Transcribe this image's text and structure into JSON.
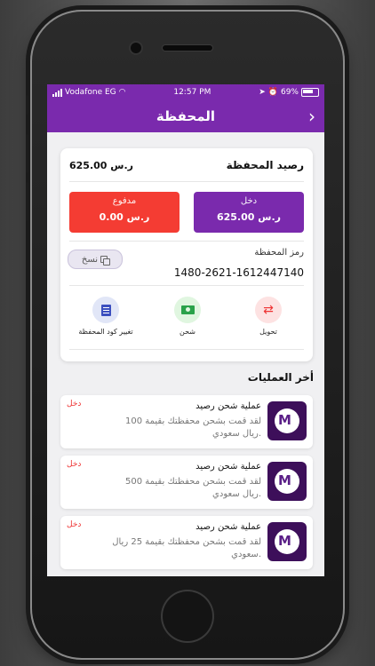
{
  "status": {
    "carrier": "Vodafone EG",
    "time": "12:57 PM",
    "battery": "69%"
  },
  "header": {
    "title": "المحفظة"
  },
  "wallet": {
    "balance_title": "رصيد المحفظة",
    "balance_amount": "625.00 ر.س",
    "income_label": "دخل",
    "income_value": "625.00 ر.س",
    "paid_label": "مدفوع",
    "paid_value": "0.00 ر.س",
    "code_label": "رمز المحفظة",
    "code_value": "1480-2621-1612447140",
    "copy_label": "نسخ"
  },
  "actions": [
    {
      "label": "تحويل",
      "icon": "transfer-arrows-icon"
    },
    {
      "label": "شحن",
      "icon": "cash-icon"
    },
    {
      "label": "تغيير كود المحفظة",
      "icon": "document-icon"
    }
  ],
  "transactions_title": "أخر العمليات",
  "transactions": [
    {
      "title": "عملية شحن رصيد",
      "desc": "لقد قمت بشحن محفظتك بقيمة 100 ريال سعودي.",
      "type": "دخل"
    },
    {
      "title": "عملية شحن رصيد",
      "desc": "لقد قمت بشحن محفظتك بقيمة 500 ريال سعودي.",
      "type": "دخل"
    },
    {
      "title": "عملية شحن رصيد",
      "desc": "لقد قمت بشحن محفظتك بقيمة 25 ريال سعودي.",
      "type": "دخل"
    }
  ],
  "colors": {
    "primary": "#7a2aad",
    "paid": "#f43c33",
    "income_text": "#e33333"
  }
}
